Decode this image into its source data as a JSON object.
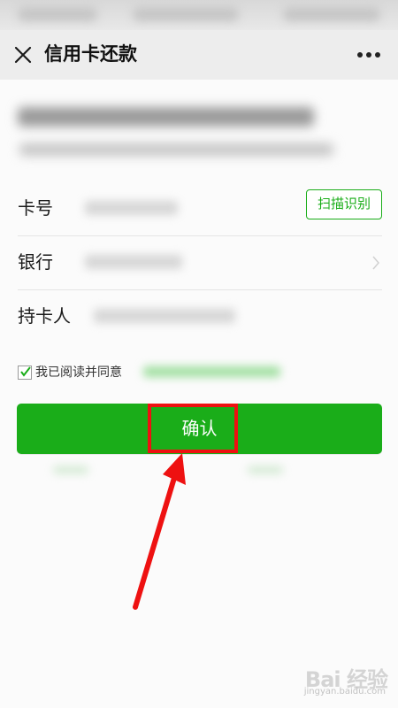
{
  "header": {
    "title": "信用卡还款"
  },
  "icons": {
    "close": "close-icon",
    "more": "more-icon",
    "chevron": "chevron-right-icon",
    "check": "check-icon",
    "arrow": "arrow-annotation"
  },
  "form": {
    "card_number_label": "卡号",
    "scan_button_label": "扫描识别",
    "bank_label": "银行",
    "holder_label": "持卡人"
  },
  "agreement": {
    "text": "我已阅读并同意",
    "checked": true
  },
  "confirm": {
    "label": "确认"
  },
  "watermark": {
    "main": "Bai 经验",
    "sub": "jingyan.baidu.com"
  },
  "colors": {
    "accent": "#1aad19",
    "annotation": "#ee1111",
    "nav_bg": "#ededed"
  }
}
